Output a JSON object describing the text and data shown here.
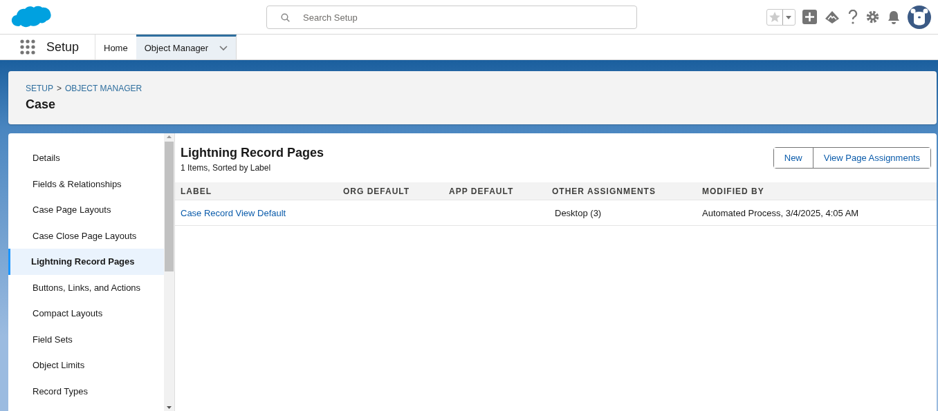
{
  "search": {
    "placeholder": "Search Setup"
  },
  "app_name": "Setup",
  "nav_tabs": [
    {
      "label": "Home",
      "selected": false,
      "has_menu": false
    },
    {
      "label": "Object Manager",
      "selected": true,
      "has_menu": true
    }
  ],
  "breadcrumb": [
    "SETUP",
    ">",
    "OBJECT MANAGER"
  ],
  "page_title": "Case",
  "sidebar": {
    "items": [
      {
        "label": "Details",
        "selected": false
      },
      {
        "label": "Fields & Relationships",
        "selected": false
      },
      {
        "label": "Case Page Layouts",
        "selected": false
      },
      {
        "label": "Case Close Page Layouts",
        "selected": false
      },
      {
        "label": "Lightning Record Pages",
        "selected": true
      },
      {
        "label": "Buttons, Links, and Actions",
        "selected": false
      },
      {
        "label": "Compact Layouts",
        "selected": false
      },
      {
        "label": "Field Sets",
        "selected": false
      },
      {
        "label": "Object Limits",
        "selected": false
      },
      {
        "label": "Record Types",
        "selected": false
      }
    ]
  },
  "section": {
    "title": "Lightning Record Pages",
    "subtitle": "1 Items, Sorted by Label",
    "buttons": [
      "New",
      "View Page Assignments"
    ]
  },
  "table": {
    "columns": [
      "LABEL",
      "ORG DEFAULT",
      "APP DEFAULT",
      "OTHER ASSIGNMENTS",
      "MODIFIED BY"
    ],
    "rows": [
      {
        "cells": [
          {
            "text": "Case Record View Default",
            "kind": "link"
          },
          {
            "kind": "empty"
          },
          {
            "kind": "empty"
          },
          {
            "text": "Desktop (3)",
            "kind": "text"
          },
          {
            "text": "Automated Process, 3/4/2025, 4:05 AM",
            "kind": "text"
          }
        ]
      }
    ]
  }
}
